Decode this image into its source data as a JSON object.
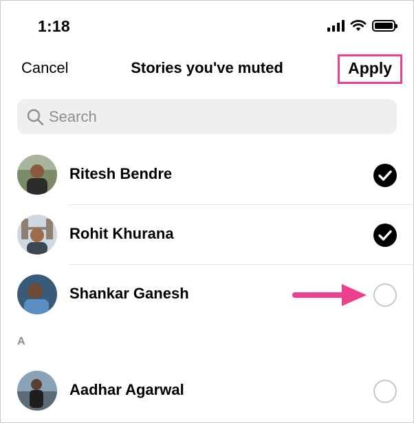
{
  "status_bar": {
    "time": "1:18",
    "icons": [
      "cellular-signal-icon",
      "wifi-icon",
      "battery-icon"
    ]
  },
  "nav": {
    "cancel_label": "Cancel",
    "title": "Stories you've muted",
    "apply_label": "Apply"
  },
  "search": {
    "placeholder": "Search",
    "icon": "search-icon"
  },
  "list": {
    "items": [
      {
        "name": "Ritesh Bendre",
        "checked": true
      },
      {
        "name": "Rohit Khurana",
        "checked": true
      },
      {
        "name": "Shankar Ganesh",
        "checked": false
      }
    ],
    "section_label": "A",
    "section_items": [
      {
        "name": "Aadhar Agarwal",
        "checked": false
      }
    ]
  },
  "colors": {
    "highlight": "#ee3f8e",
    "checked": "#000000",
    "unchecked_border": "#c7c7c7",
    "search_bg": "#efefef"
  }
}
